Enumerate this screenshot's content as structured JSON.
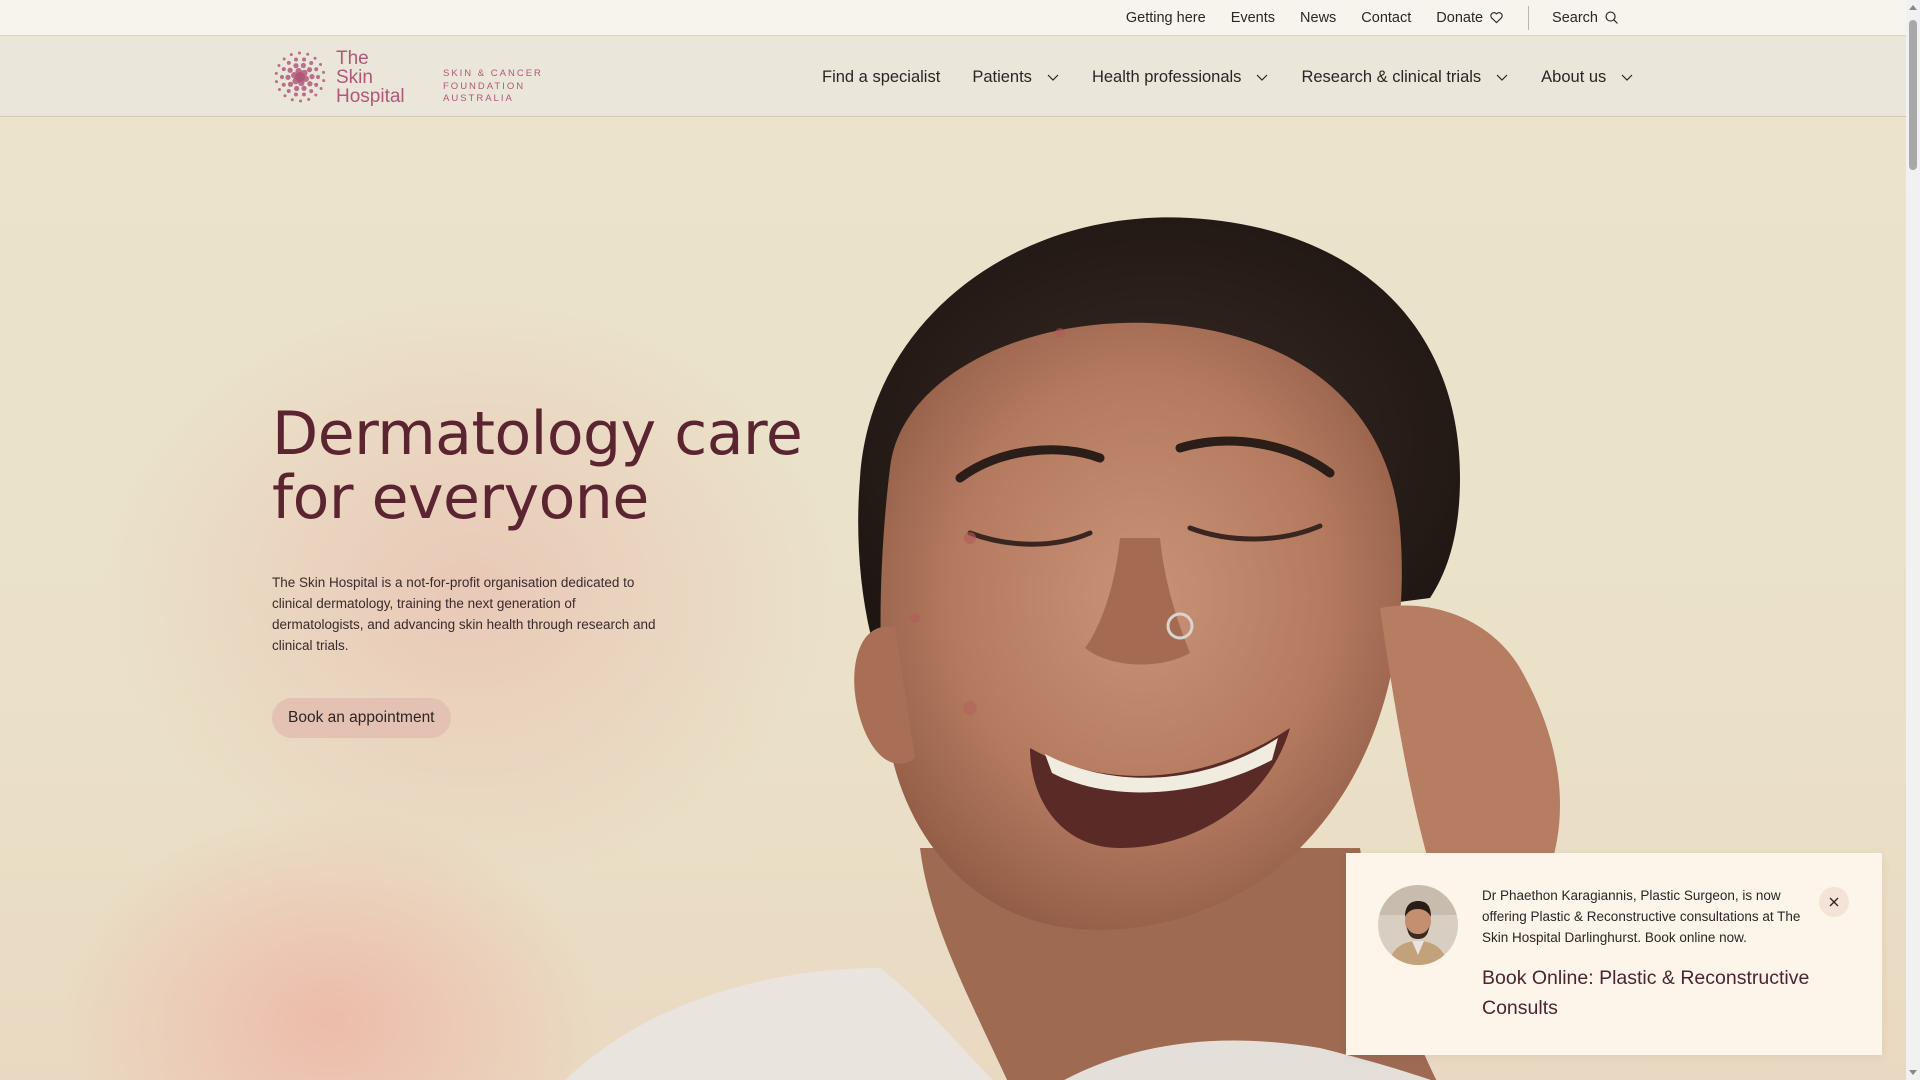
{
  "utility_nav": {
    "items": [
      {
        "label": "Getting here"
      },
      {
        "label": "Events"
      },
      {
        "label": "News"
      },
      {
        "label": "Contact"
      }
    ],
    "donate_label": "Donate",
    "search_label": "Search"
  },
  "logo": {
    "line1": "The",
    "line2": "Skin",
    "line3": "Hospital",
    "foundation_line1": "SKIN & CANCER",
    "foundation_line2": "FOUNDATION",
    "foundation_line3": "AUSTRALIA",
    "accent_color": "#b0587a"
  },
  "main_nav": {
    "items": [
      {
        "label": "Find a specialist"
      },
      {
        "label": "Patients"
      },
      {
        "label": "Health professionals"
      },
      {
        "label": "Research & clinical trials"
      },
      {
        "label": "About us"
      }
    ]
  },
  "hero": {
    "title_line1": "Dermatology care",
    "title_line2": "for everyone",
    "body": "The Skin Hospital is a not-for-profit organisation dedicated to clinical dermatology, training the next generation of dermatologists, and advancing skin health through research and clinical trials.",
    "cta_label": "Book an appointment",
    "title_color": "#5b2431"
  },
  "popup": {
    "text": "Dr Phaethon Karagiannis, Plastic Surgeon, is now offering Plastic & Reconstructive consultations at The Skin Hospital Darlinghurst. Book online now.",
    "link_label": "Book Online: Plastic & Reconstructive Consults"
  }
}
